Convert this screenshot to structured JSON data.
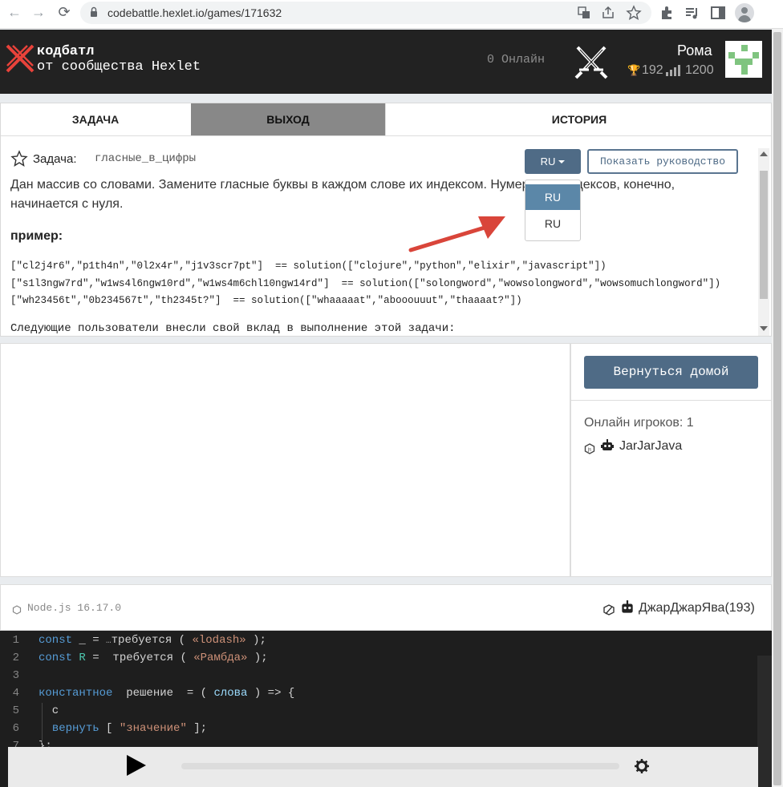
{
  "browser": {
    "url": "codebattle.hexlet.io/games/171632",
    "back_glyph": "←",
    "forward_glyph": "→",
    "reload_glyph": "⟳"
  },
  "header": {
    "logo_title": "кодбатл",
    "logo_subtitle": "от сообщества Hexlet",
    "online": "0 Онлайн",
    "user_name": "Рома",
    "rank": "192",
    "rating": "1200"
  },
  "tabs": {
    "task": "ЗАДАЧА",
    "output": "ВЫХОД",
    "history": "ИСТОРИЯ"
  },
  "task": {
    "label": "Задача:",
    "name": "гласные_в_цифры",
    "description": "Дан массив со словами. Замените гласные буквы в каждом слове их индексом. Нумерация индексов, конечно, начинается с нуля.",
    "example_label": "пример:",
    "examples": [
      "[\"cl2j4r6\",\"p1th4n\",\"0l2x4r\",\"j1v3scr7pt\"]  == solution([\"clojure\",\"python\",\"elixir\",\"javascript\"])",
      "[\"s1l3ngw7rd\",\"w1ws4l6ngw10rd\",\"w1ws4m6chl10ngw14rd\"]  == solution([\"solongword\",\"wowsolongword\",\"wowsomuchlongword\"])",
      "[\"wh23456t\",\"0b234567t\",\"th2345t?\"]  == solution([\"whaaaaat\",\"abooouuut\",\"thaaaat?\"])"
    ],
    "contributors": "Следующие пользователи внесли свой вклад в выполнение этой задачи:"
  },
  "language": {
    "selected": "RU",
    "options": [
      "RU",
      "RU"
    ],
    "guide_button": "Показать руководство"
  },
  "sidebar": {
    "home_button": "Вернуться домой",
    "online_players": "Онлайн игроков: 1",
    "players": [
      "JarJarJava"
    ]
  },
  "editor": {
    "runtime": "Node.js 16.17.0",
    "opponent": "ДжарДжарЯва(193)",
    "line_numbers": [
      "1",
      "2",
      "3",
      "4",
      "5",
      "6",
      "7"
    ]
  },
  "colors": {
    "header_bg": "#222222",
    "accent": "#4f6b86",
    "dropdown_active": "#5b87a8",
    "arrow": "#d9453a",
    "editor_bg": "#1e1e1e"
  }
}
